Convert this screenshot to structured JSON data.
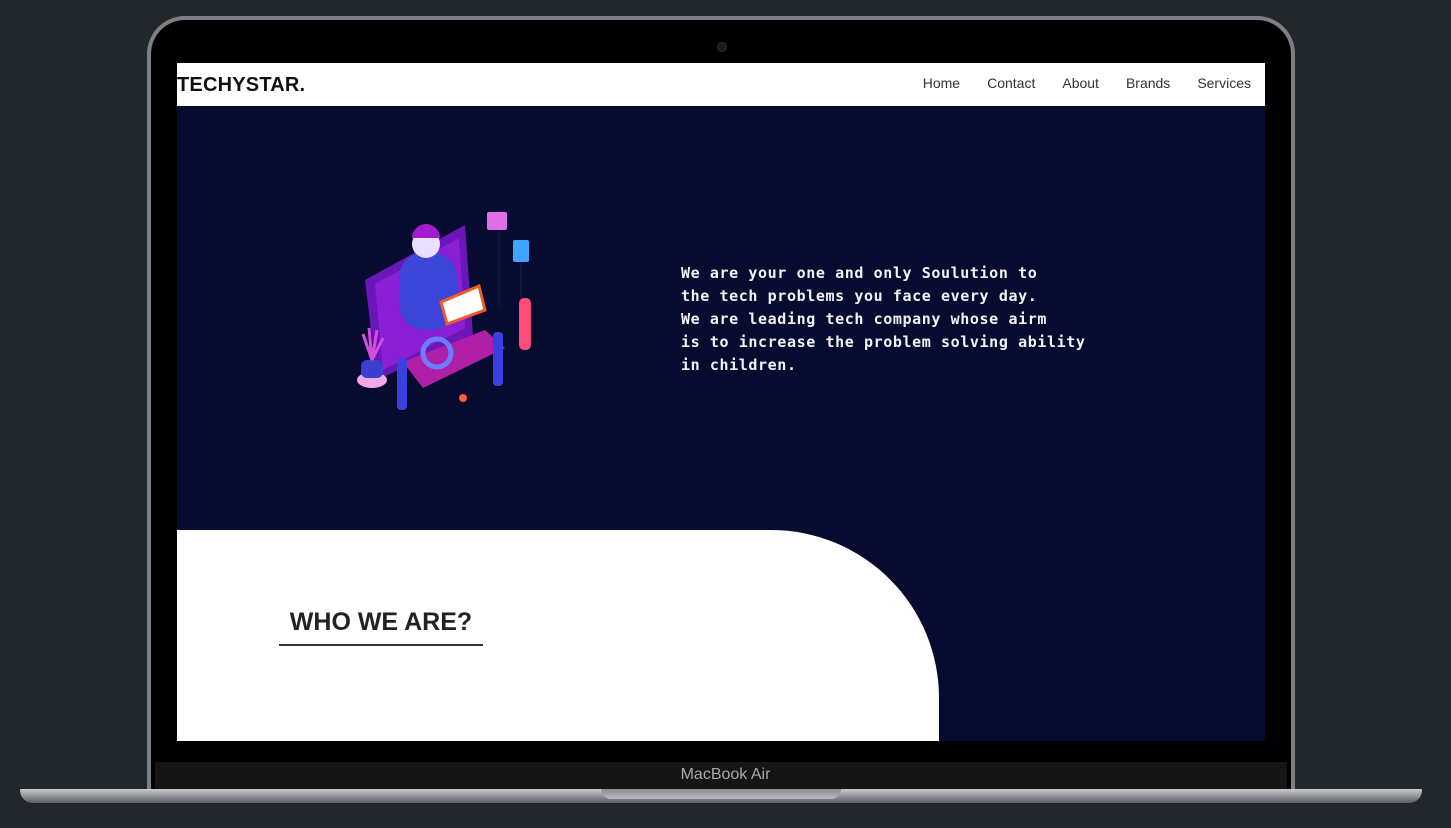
{
  "device": {
    "label": "MacBook Air"
  },
  "navbar": {
    "brand": "TECHYSTAR.",
    "links": [
      "Home",
      "Contact",
      "About",
      "Brands",
      "Services"
    ]
  },
  "hero": {
    "text": "We are your one and only Soulution to\nthe tech problems you face every day.\nWe are leading tech company whose airm\nis to increase the problem solving ability\nin children.",
    "illustration": "tech-support-isometric-illustration"
  },
  "section": {
    "title": "WHO WE ARE?"
  },
  "colors": {
    "hero_bg": "#070b30",
    "navbar_bg": "#ffffff",
    "page_bg": "#22272b"
  }
}
